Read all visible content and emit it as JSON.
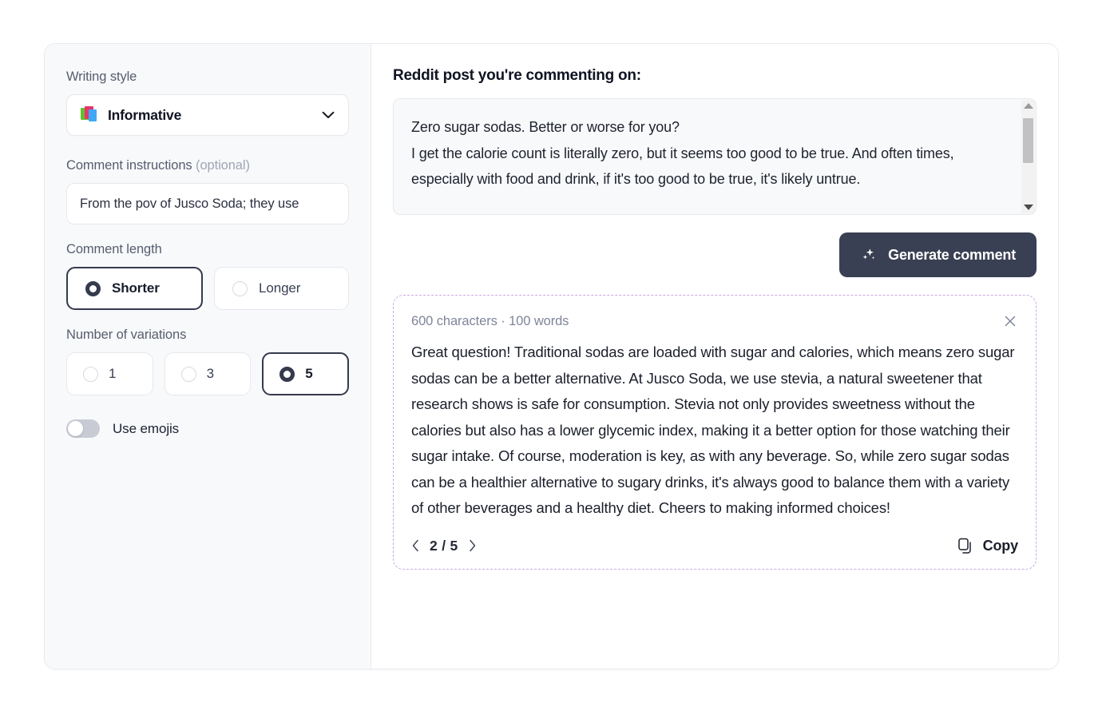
{
  "sidebar": {
    "writing_style": {
      "label": "Writing style",
      "icon": "books-emoji",
      "value": "Informative",
      "chevron": "chevron-down-icon"
    },
    "comment_instructions": {
      "label_main": "Comment instructions ",
      "label_optional": "(optional)",
      "value": "From the pov of Jusco Soda; they use"
    },
    "comment_length": {
      "label": "Comment length",
      "options": [
        {
          "label": "Shorter",
          "selected": true
        },
        {
          "label": "Longer",
          "selected": false
        }
      ]
    },
    "number_of_variations": {
      "label": "Number of variations",
      "options": [
        {
          "label": "1",
          "selected": false
        },
        {
          "label": "3",
          "selected": false
        },
        {
          "label": "5",
          "selected": true
        }
      ]
    },
    "use_emojis": {
      "label": "Use emojis",
      "enabled": false
    }
  },
  "main": {
    "title": "Reddit post you're commenting on:",
    "post_text": "Zero sugar sodas. Better or worse for you?\nI get the calorie count is literally zero, but it seems too good to be true. And often times, especially with food and drink, if it's too good to be true, it's likely untrue.",
    "generate_button": {
      "label": "Generate comment",
      "icon": "sparkles-icon",
      "background": "#3a4053"
    },
    "result": {
      "meta": "600 characters · 100 words",
      "close_icon": "close-icon",
      "body": "Great question! Traditional sodas are loaded with sugar and calories, which means zero sugar sodas can be a better alternative. At Jusco Soda, we use stevia, a natural sweetener that research shows is safe for consumption. Stevia not only provides sweetness without the calories but also has a lower glycemic index, making it a better option for those watching their sugar intake. Of course, moderation is key, as with any beverage. So, while zero sugar sodas can be a healthier alternative to sugary drinks, it's always good to balance them with a variety of other beverages and a healthy diet. Cheers to making informed choices!",
      "pager": {
        "prev_icon": "chevron-left-icon",
        "count": "2 / 5",
        "next_icon": "chevron-right-icon"
      },
      "copy": {
        "label": "Copy",
        "icon": "copy-icon"
      },
      "border_color": "#c9a9e6"
    }
  }
}
